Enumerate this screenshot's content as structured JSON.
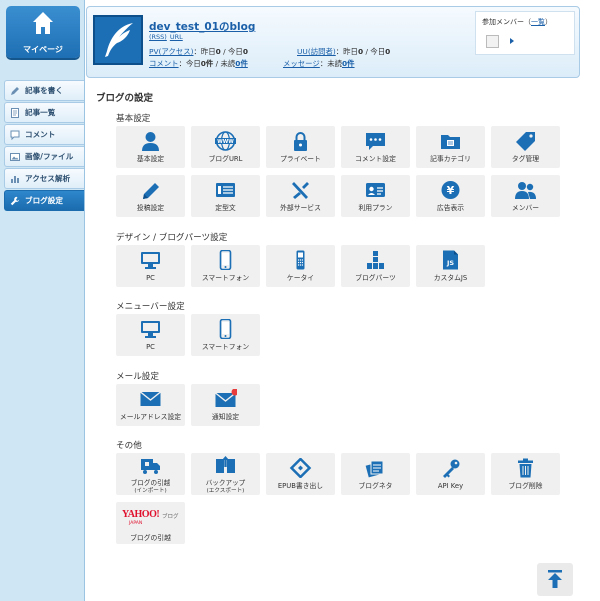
{
  "sidebar": {
    "mypage_label": "マイページ",
    "items": [
      {
        "label": "記事を書く"
      },
      {
        "label": "記事一覧"
      },
      {
        "label": "コメント"
      },
      {
        "label": "画像/ファイル"
      },
      {
        "label": "アクセス解析"
      },
      {
        "label": "ブログ設定"
      }
    ]
  },
  "header": {
    "blog_name": "dev_test_01のblog",
    "link_rss": "(RSS)",
    "link_url": "URL",
    "pv_label": "PV(アクセス)",
    "pv_text": "：昨日",
    "pv_yesterday": "0",
    "pv_sep": " / 今日",
    "pv_today": "0",
    "uu_label": "UU(訪問者)",
    "uu_text": "：昨日",
    "uu_yesterday": "0",
    "uu_sep": " / 今日",
    "uu_today": "0",
    "comment_label": "コメント",
    "comment_text": "：今日",
    "comment_today": "0件",
    "comment_sep": " / 未読",
    "comment_unread": "0件",
    "message_label": "メッセージ",
    "message_text": "：未読",
    "message_unread": "0件",
    "members_title": "参加メンバー",
    "members_link": "一覧"
  },
  "page_title": "ブログの設定",
  "sections": {
    "basic": {
      "title": "基本設定",
      "row1": [
        "基本設定",
        "ブログURL",
        "プライベート",
        "コメント設定",
        "記事カテゴリ",
        "タグ管理"
      ],
      "row2": [
        "投稿設定",
        "定型文",
        "外部サービス",
        "利用プラン",
        "広告表示",
        "メンバー"
      ]
    },
    "design": {
      "title": "デザイン / ブログパーツ設定",
      "items": [
        "PC",
        "スマートフォン",
        "ケータイ",
        "ブログパーツ",
        "カスタムJS"
      ]
    },
    "menubar": {
      "title": "メニューバー設定",
      "items": [
        "PC",
        "スマートフォン"
      ]
    },
    "mail": {
      "title": "メール設定",
      "items": [
        "メールアドレス設定",
        "通知設定"
      ]
    },
    "other": {
      "title": "その他",
      "import_label": "ブログの引越",
      "import_sub": "(インポート)",
      "backup_label": "バックアップ",
      "backup_sub": "(エクスポート)",
      "items": [
        "EPUB書き出し",
        "ブログネタ",
        "API Key",
        "ブログ削除"
      ],
      "yahoo_logo": "YAHOO!",
      "yahoo_blog": "ブログ",
      "yahoo_sub": "JAPAN",
      "yahoo_label": "ブログの引越"
    }
  },
  "colors": {
    "accent": "#1c6fb5",
    "tile": "#f0f0f0",
    "badge": "#e83b3b"
  }
}
